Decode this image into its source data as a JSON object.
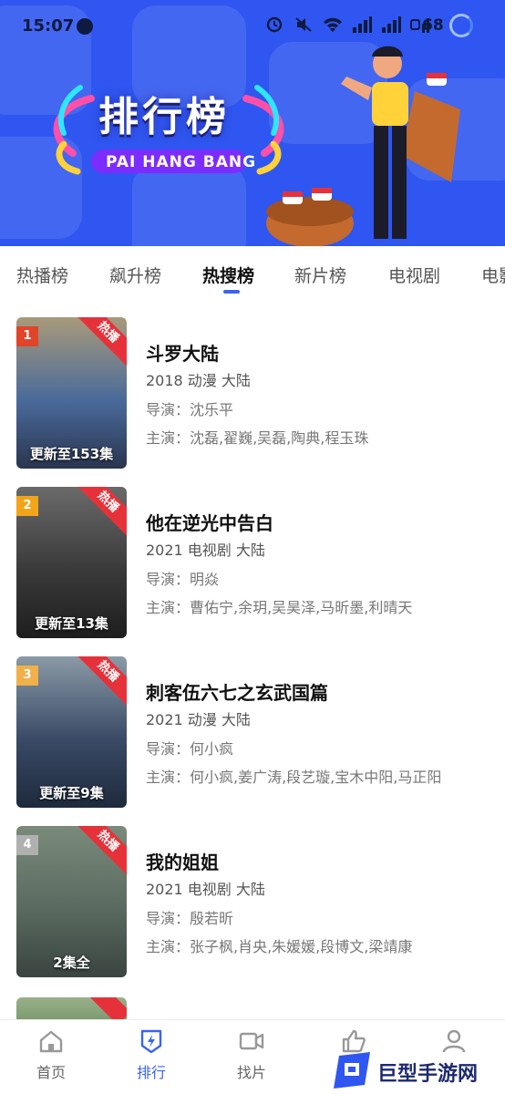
{
  "status_bar": {
    "time": "15:07",
    "battery": "68"
  },
  "banner": {
    "title": "排行榜",
    "subtitle": "PAI HANG BANG"
  },
  "tabs": [
    {
      "label": "热播榜"
    },
    {
      "label": "飙升榜"
    },
    {
      "label": "热搜榜",
      "active": true
    },
    {
      "label": "新片榜"
    },
    {
      "label": "电视剧"
    },
    {
      "label": "电影"
    }
  ],
  "list": [
    {
      "rank": "1",
      "badge": "热播",
      "poster_caption": "更新至153集",
      "title": "斗罗大陆",
      "meta": "2018  动漫  大陆",
      "director": "导演：沈乐平",
      "cast": "主演：沈磊,翟巍,吴磊,陶典,程玉珠",
      "poster_colors": [
        "#a89a7a",
        "#4a6a9a",
        "#2a3550"
      ]
    },
    {
      "rank": "2",
      "badge": "热播",
      "poster_caption": "更新至13集",
      "title": "他在逆光中告白",
      "meta": "2021  电视剧  大陆",
      "director": "导演：明焱",
      "cast": "主演：曹佑宁,余玥,吴昊泽,马昕墨,利晴天",
      "poster_colors": [
        "#5a5a5a",
        "#3a3a3a",
        "#222222"
      ]
    },
    {
      "rank": "3",
      "badge": "热播",
      "poster_caption": "更新至9集",
      "title": "刺客伍六七之玄武国篇",
      "meta": "2021  动漫  大陆",
      "director": "导演：何小疯",
      "cast": "主演：何小疯,姜广涛,段艺璇,宝木中阳,马正阳",
      "poster_colors": [
        "#8a9aa6",
        "#3a4a66",
        "#1e2a3c"
      ]
    },
    {
      "rank": "4",
      "badge": "热播",
      "poster_caption": "2集全",
      "title": "我的姐姐",
      "meta": "2021  电视剧  大陆",
      "director": "导演：殷若昕",
      "cast": "主演：张子枫,肖央,朱媛媛,段博文,梁靖康",
      "poster_colors": [
        "#7a8a7a",
        "#5a6a60",
        "#3a4440"
      ]
    }
  ],
  "bottom_nav": [
    {
      "label": "首页",
      "icon": "home-icon"
    },
    {
      "label": "排行",
      "icon": "ranking-icon",
      "active": true
    },
    {
      "label": "找片",
      "icon": "video-camera-icon"
    },
    {
      "label": "",
      "icon": "thumb-up-icon"
    },
    {
      "label": "",
      "icon": "user-icon"
    }
  ],
  "watermark": {
    "text": "巨型手游网"
  },
  "colors": {
    "accent": "#3a63f0",
    "banner": "#2f56f0",
    "hot_badge": "#e5323a"
  }
}
